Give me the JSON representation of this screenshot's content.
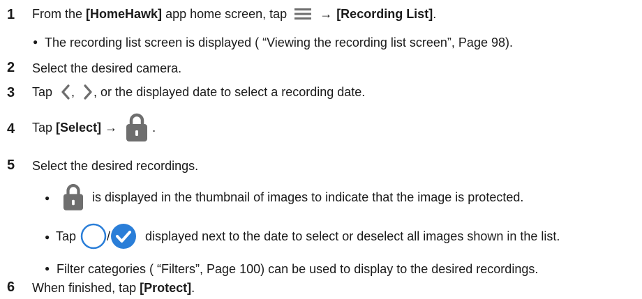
{
  "steps": [
    {
      "number": "1",
      "text_a": "From the ",
      "text_bold_a": "[HomeHawk]",
      "text_b": " app home screen, tap ",
      "arrow": "→",
      "text_bold_b": "[Recording List]",
      "text_c": ".",
      "bullets": [
        {
          "text": "The recording list screen is displayed ( “Viewing the recording list screen”, Page 98)."
        }
      ]
    },
    {
      "number": "2",
      "text": "Select the desired camera."
    },
    {
      "number": "3",
      "text_a": "Tap ",
      "text_b": ", ",
      "text_c": ", or the displayed date to select a recording date."
    },
    {
      "number": "4",
      "text_a": "Tap ",
      "text_bold": "[Select]",
      "arrow": " →",
      "text_b": "."
    },
    {
      "number": "5",
      "text": "Select the desired recordings.",
      "bullets": [
        {
          "text": "is displayed in the thumbnail of images to indicate that the image is protected."
        },
        {
          "text_a": "Tap",
          "sep": "/",
          "text_b": "displayed next to the date to select or deselect all images shown in the list."
        },
        {
          "text": "Filter categories ( “Filters”, Page 100) can be used to display to the desired recordings."
        }
      ]
    },
    {
      "number": "6",
      "text_a": "When finished, tap ",
      "text_bold": "[Protect]",
      "text_b": "."
    }
  ],
  "bullet_symbol": "●",
  "icons": {
    "menu": "hamburger-menu-icon",
    "prev": "chevron-left-icon",
    "next": "chevron-right-icon",
    "lock": "lock-icon",
    "select_empty": "circle-empty-icon",
    "select_checked": "circle-check-icon"
  },
  "colors": {
    "text": "#1a1a1a",
    "icon_gray": "#6e6e6e",
    "check_blue": "#2a7ed8"
  }
}
